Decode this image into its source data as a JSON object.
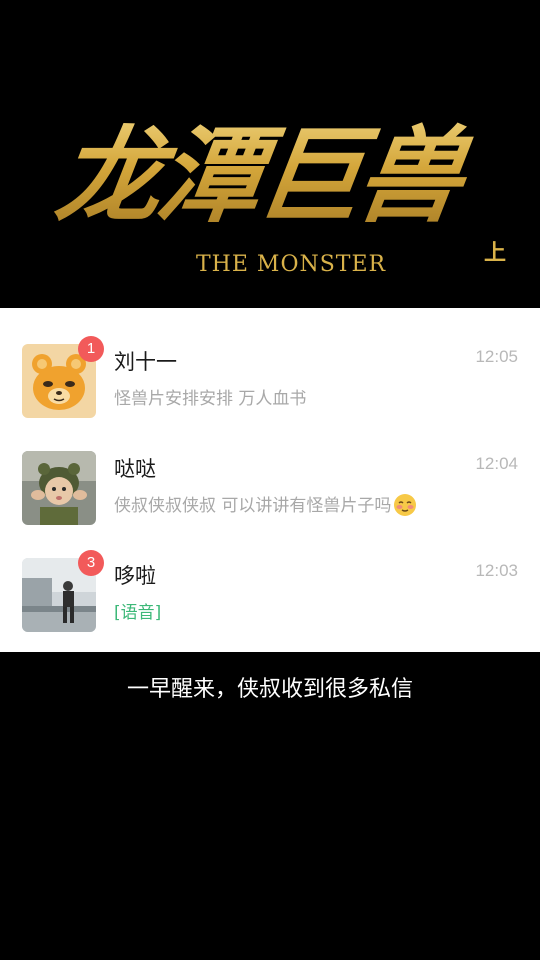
{
  "banner": {
    "title_cn": "龙潭巨兽",
    "title_en": "THE MONSTER",
    "part": "上"
  },
  "chats": [
    {
      "name": "刘十一",
      "preview": "怪兽片安排安排 万人血书",
      "time": "12:05",
      "unread": "1",
      "avatar_icon": "cartoon-bear-icon"
    },
    {
      "name": "哒哒",
      "preview": "侠叔侠叔侠叔 可以讲讲有怪兽片子吗",
      "time": "12:04",
      "unread": "",
      "avatar_icon": "child-photo-avatar",
      "emoji": "blushing-face-emoji"
    },
    {
      "name": "哆啦",
      "preview": "[语音]",
      "time": "12:03",
      "unread": "3",
      "avatar_icon": "person-photo-avatar"
    }
  ],
  "caption": "一早醒来，侠叔收到很多私信",
  "colors": {
    "gold": "#d9b24a",
    "badge": "#f25a5a",
    "voice": "#3cb878"
  }
}
